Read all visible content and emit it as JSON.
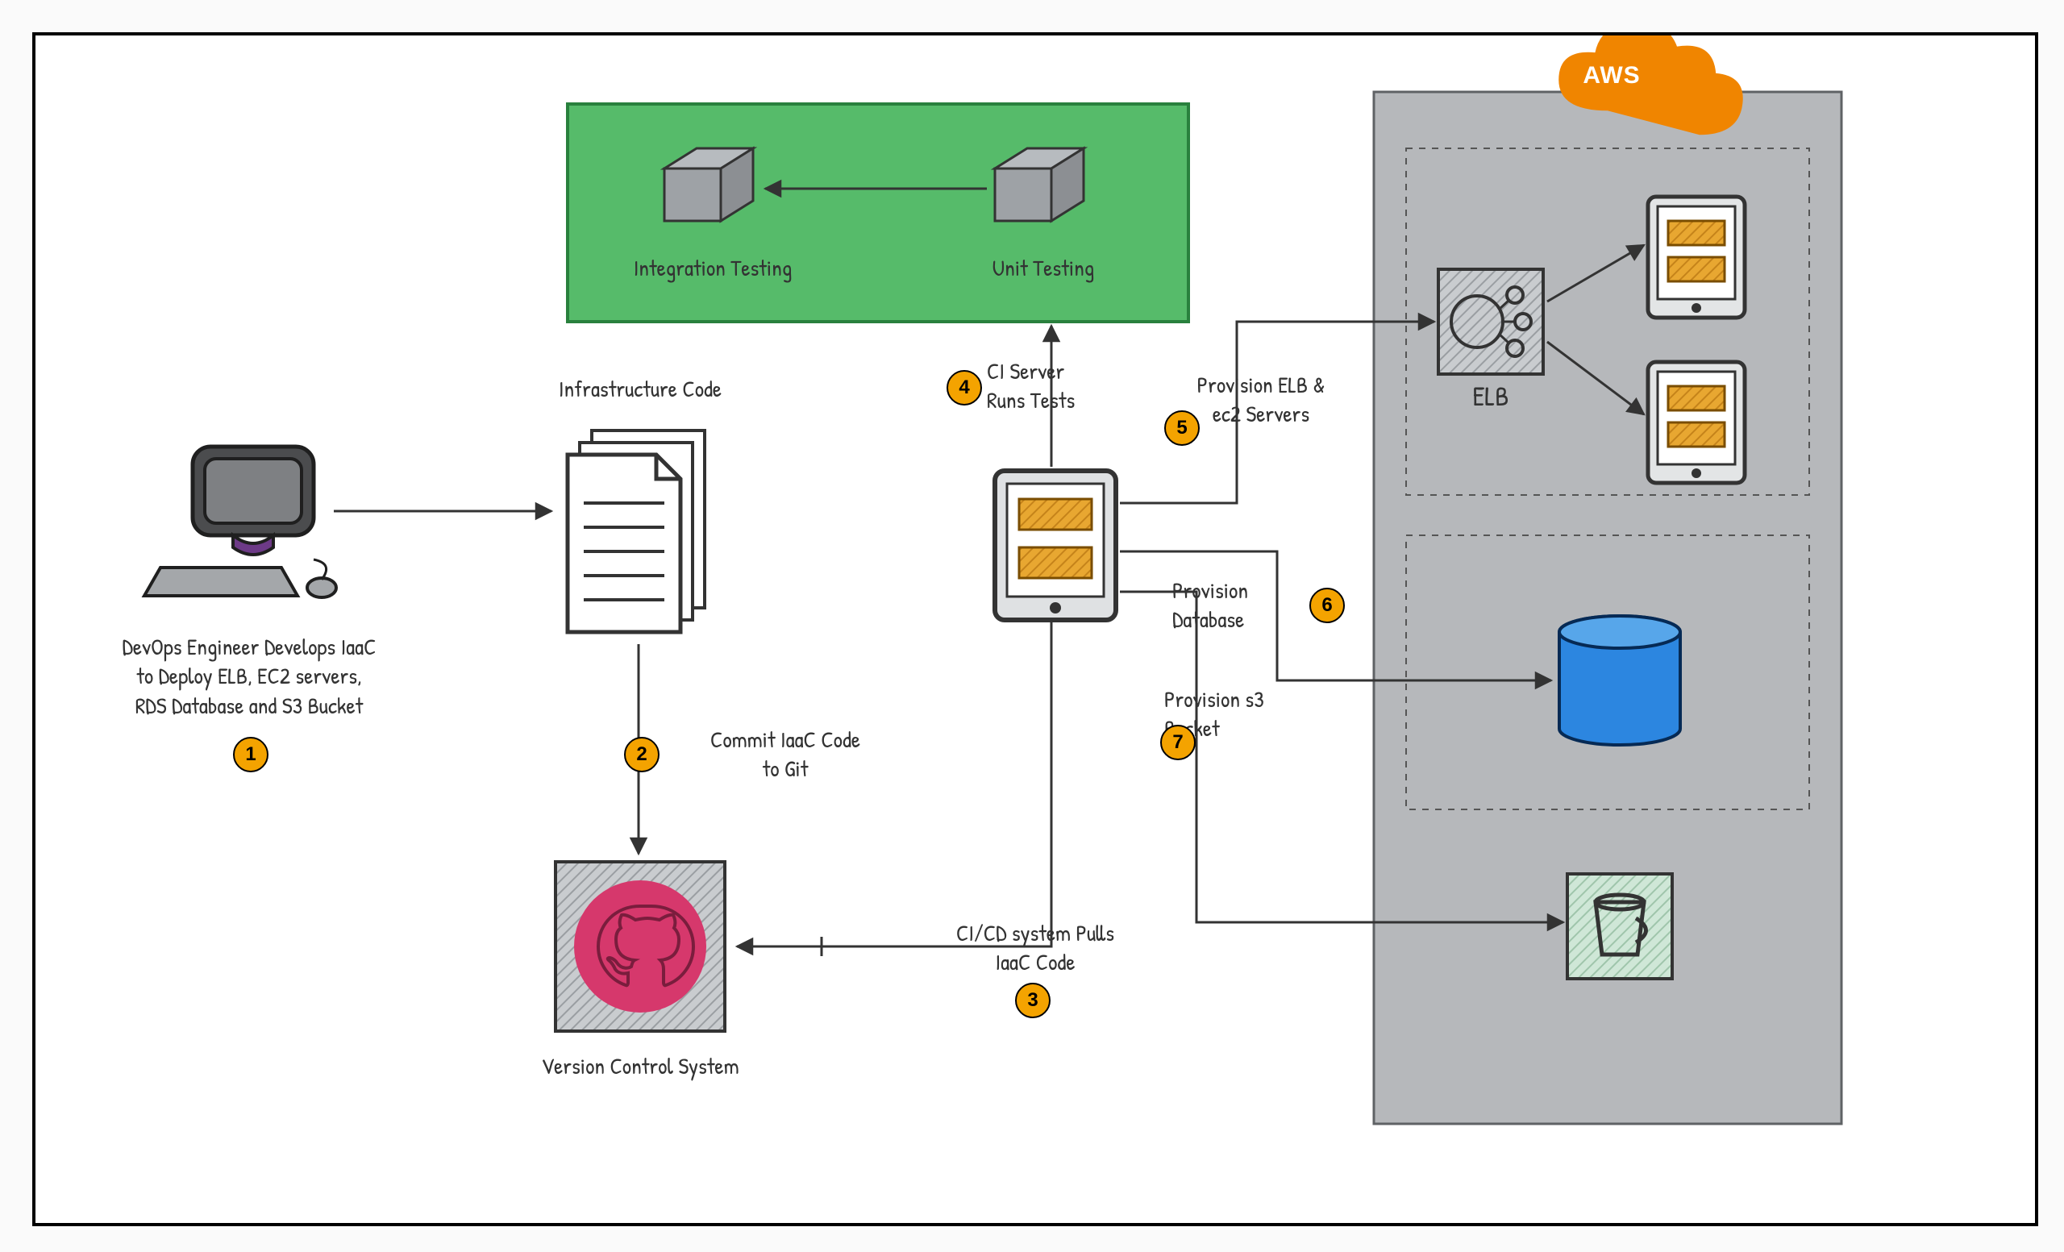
{
  "steps": {
    "s1": {
      "n": "1",
      "text": "DevOps Engineer Develops IaaC\nto Deploy ELB, EC2 servers,\nRDS Database and S3 Bucket"
    },
    "s2": {
      "n": "2",
      "text": "Commit IaaC Code\nto Git"
    },
    "s3": {
      "n": "3",
      "text": "CI/CD system Pulls\nIaaC Code"
    },
    "s4": {
      "n": "4",
      "text": "CI Server\nRuns Tests"
    },
    "s5": {
      "n": "5",
      "text": "Provision ELB &\nec2 Servers"
    },
    "s6": {
      "n": "6",
      "text": "Provision\nDatabase"
    },
    "s7": {
      "n": "7",
      "text": "Provision s3\nBucket"
    }
  },
  "nodes": {
    "infra_code": "Infrastructure Code",
    "vcs": "Version Control System",
    "integration_testing": "Integration Testing",
    "unit_testing": "Unit Testing",
    "elb": "ELB",
    "aws": "AWS"
  },
  "colors": {
    "testing_box": "#56bb6a",
    "testing_box_border": "#29803d",
    "aws_panel": "#b6b8bb",
    "aws_cloud": "#f08500",
    "badge": "#f4a300",
    "github": "#d6386c",
    "db_blue": "#2c86e0",
    "ec2_fill": "#e8a731"
  }
}
